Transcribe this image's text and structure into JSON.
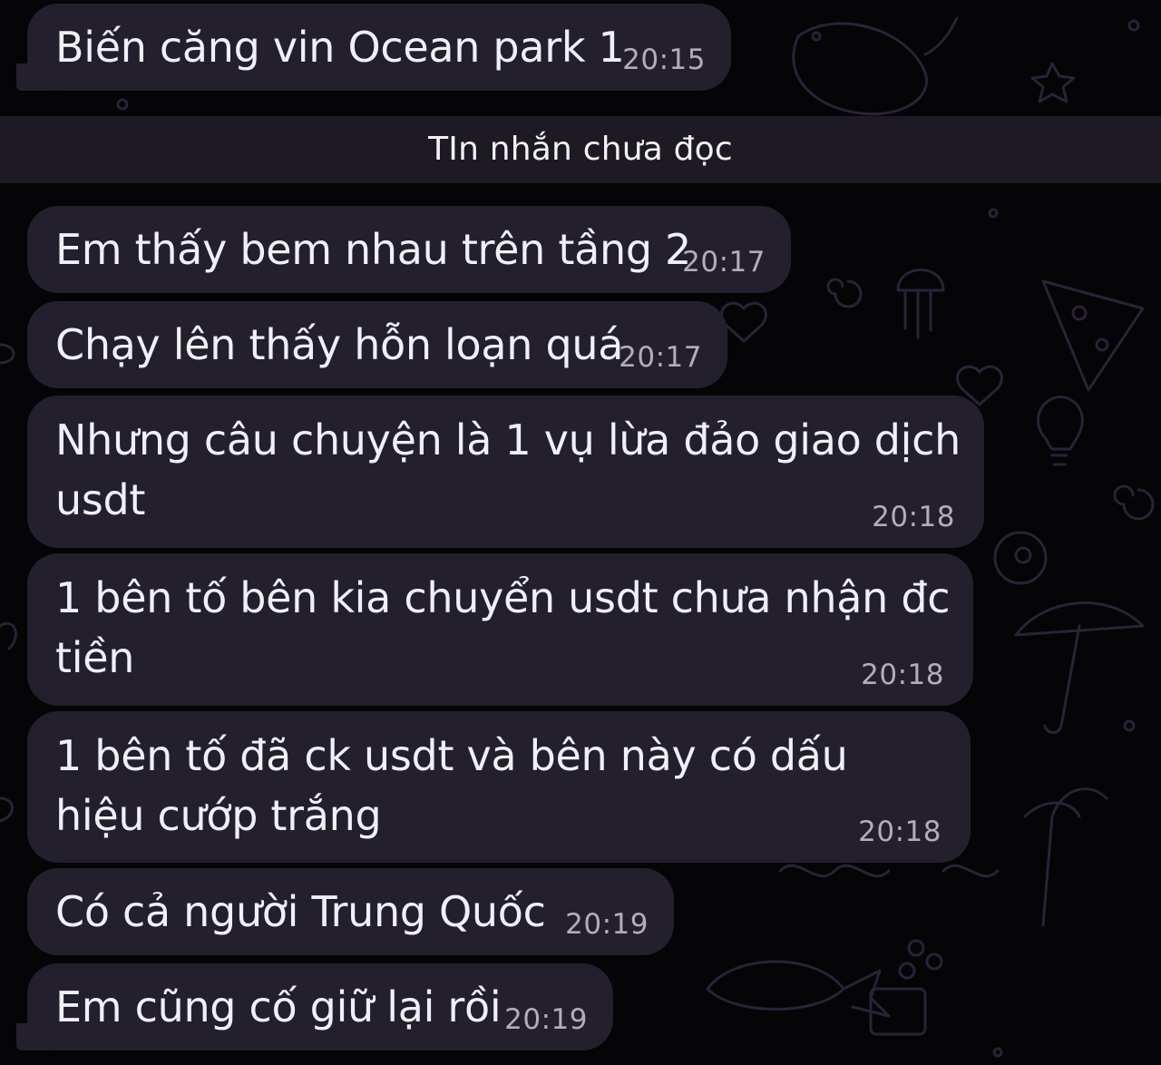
{
  "divider": {
    "label": "TIn nhắn chưa đọc"
  },
  "messages": [
    {
      "text": "Biến căng vin Ocean park 1",
      "time": "20:15"
    },
    {
      "text": "Em thấy bem nhau trên tầng 2",
      "time": "20:17"
    },
    {
      "text": "Chạy lên thấy hỗn loạn quá",
      "time": "20:17"
    },
    {
      "text": "Nhưng câu chuyện là 1 vụ lừa đảo giao dịch usdt",
      "time": "20:18"
    },
    {
      "text": "1 bên tố bên kia chuyển usdt chưa nhận đc tiền",
      "time": "20:18"
    },
    {
      "text": "1 bên tố đã ck usdt và bên này có dấu hiệu cướp trắng",
      "time": "20:18"
    },
    {
      "text": "Có cả người Trung Quốc",
      "time": "20:19"
    },
    {
      "text": "Em cũng cố giữ lại rồi",
      "time": "20:19"
    }
  ],
  "colors": {
    "background": "#050407",
    "bubble": "#231f2c",
    "divider": "#1d1a23",
    "text": "#f1eff6",
    "time": "#b2acbc"
  }
}
